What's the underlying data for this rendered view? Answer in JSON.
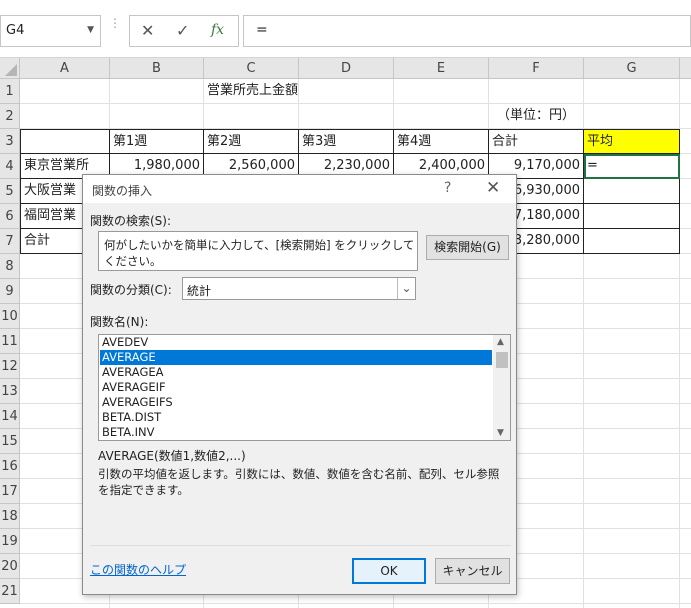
{
  "formula_bar": {
    "name_box": "G4",
    "cancel_icon": "✕",
    "enter_icon": "✓",
    "fx_label": "fx",
    "formula": "="
  },
  "columns": [
    "A",
    "B",
    "C",
    "D",
    "E",
    "F",
    "G"
  ],
  "rows": [
    "1",
    "2",
    "3",
    "4",
    "5",
    "6",
    "7",
    "8",
    "9",
    "10",
    "11",
    "12",
    "13",
    "14",
    "15",
    "16",
    "17",
    "18",
    "19",
    "20",
    "21"
  ],
  "sheet": {
    "title": "営業所売上金額",
    "unit": "（単位：円）",
    "headers": [
      "第1週",
      "第2週",
      "第3週",
      "第4週",
      "合計",
      "平均"
    ],
    "r4": {
      "name": "東京営業所",
      "w1": "1,980,000",
      "w2": "2,560,000",
      "w3": "2,230,000",
      "w4": "2,400,000",
      "total": "9,170,000",
      "avg": "="
    },
    "r5": {
      "name": "大阪営業",
      "total": "6,930,000"
    },
    "r6": {
      "name": "福岡営業",
      "total": "7,180,000"
    },
    "r7": {
      "name": "合計",
      "total": "3,280,000"
    }
  },
  "dialog": {
    "title": "関数の挿入",
    "help_icon": "?",
    "close_icon": "✕",
    "search_label": "関数の検索(S):",
    "search_text": "何がしたいかを簡単に入力して、[検索開始] をクリックしてください。",
    "search_button": "検索開始(G)",
    "category_label": "関数の分類(C):",
    "category_value": "統計",
    "function_name_label": "関数名(N):",
    "functions": [
      "AVEDEV",
      "AVERAGE",
      "AVERAGEA",
      "AVERAGEIF",
      "AVERAGEIFS",
      "BETA.DIST",
      "BETA.INV"
    ],
    "selected_function": "AVERAGE",
    "syntax": "AVERAGE(数値1,数値2,...)",
    "description": "引数の平均値を返します。引数には、数値、数値を含む名前、配列、セル参照を指定できます。",
    "help_link": "この関数のヘルプ",
    "ok_button": "OK",
    "cancel_button": "キャンセル"
  }
}
